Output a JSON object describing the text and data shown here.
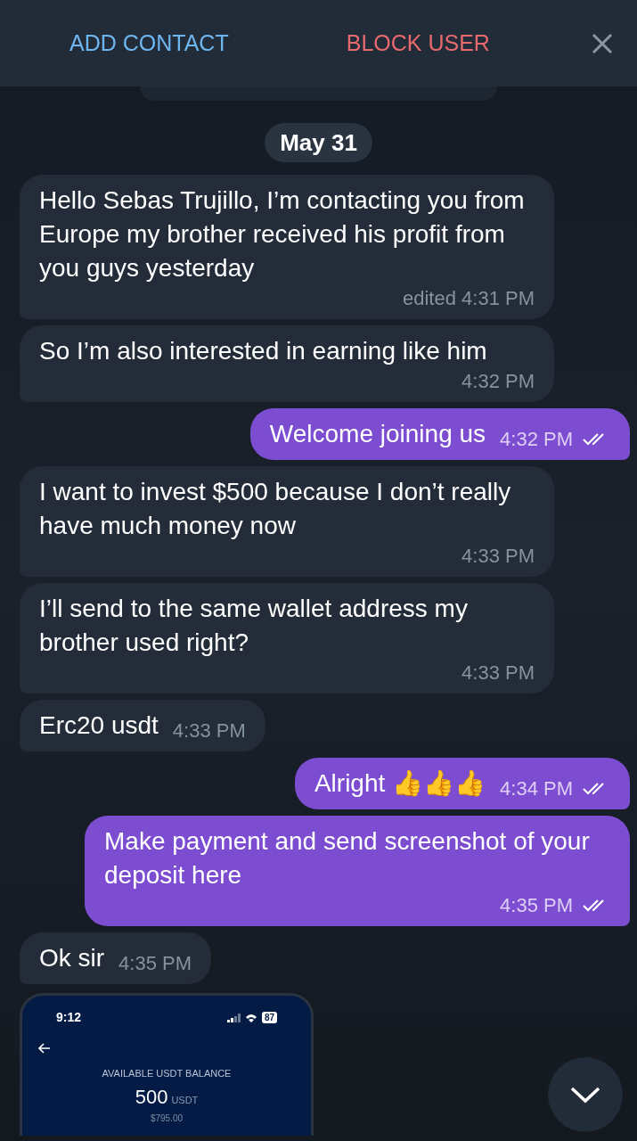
{
  "top_bar": {
    "add_contact": "ADD CONTACT",
    "block_user": "BLOCK USER"
  },
  "date_chip": "May 31",
  "messages": [
    {
      "kind": "incoming",
      "text": "Hello Sebas Trujillo, I’m contacting you from Europe my brother received his profit from you guys yesterday",
      "time": "edited 4:31 PM"
    },
    {
      "kind": "incoming",
      "text": "So I’m also interested in earning like him",
      "time": "4:32 PM"
    },
    {
      "kind": "outgoing",
      "text": "Welcome joining us",
      "time": "4:32 PM",
      "read": true
    },
    {
      "kind": "incoming",
      "text": "I want to invest $500 because I don’t really have much money now",
      "time": "4:33 PM"
    },
    {
      "kind": "incoming",
      "text": "I’ll send to the same wallet address my brother used right?",
      "time": "4:33 PM"
    },
    {
      "kind": "incoming",
      "text": "Erc20 usdt",
      "time": "4:33 PM"
    },
    {
      "kind": "outgoing",
      "text": "Alright 👍👍👍",
      "time": "4:34 PM",
      "read": true
    },
    {
      "kind": "outgoing",
      "text": "Make payment and send screenshot of your deposit here",
      "time": "4:35 PM",
      "read": true
    },
    {
      "kind": "incoming",
      "text": "Ok sir",
      "time": "4:35 PM"
    }
  ],
  "image_message": {
    "status_time": "9:12",
    "battery": "87",
    "balance_label": "AVAILABLE USDT BALANCE",
    "amount": "500",
    "unit": "USDT",
    "usd_value": "$795.00"
  }
}
